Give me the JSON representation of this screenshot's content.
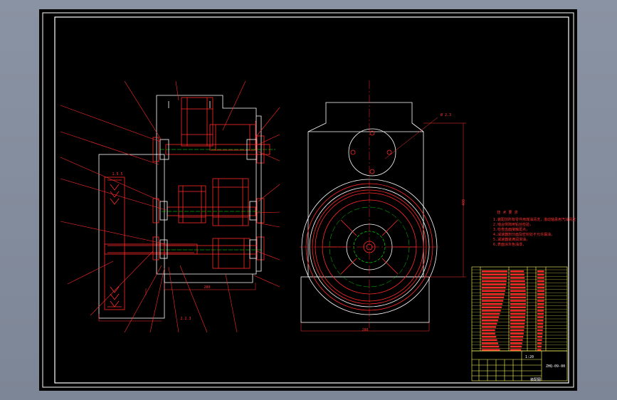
{
  "drawing": {
    "view_top_dimension": "1",
    "cover_top_dimension": "Ø 2.3",
    "side_dimension": "400",
    "base_dimension": "280",
    "bottom_dimension_1": "280",
    "bottom_dimension_2": "2.2.3",
    "pulley_dimension": "1.5.5"
  },
  "notes": {
    "title": "技 术 要 求",
    "lines": [
      "1.装配前所有零件用煤油清洗，滚动轴承用汽油清洗",
      "2.啮合侧隙用铅丝检验，",
      "3.检查齿面接触斑点，",
      "4.减速器剖分面及密封处不允许漏油，",
      "5.减速器装满润滑油，",
      "6.表面涂灰色油漆，"
    ]
  },
  "title_block": {
    "scale": "1:20",
    "drawing_no": "ZHQ-09-00",
    "name": "装配图"
  },
  "colors": {
    "background": "#000000",
    "outline": "#ffffff",
    "part": "#ff2a2a",
    "dim": "#ff3333",
    "green": "#00ff00"
  }
}
